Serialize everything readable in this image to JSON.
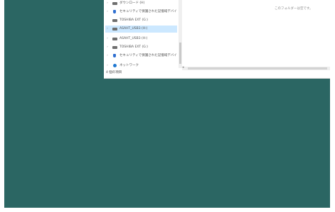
{
  "nav_pane": {
    "items": [
      {
        "label": "ダウンロード (H)",
        "icon": "drive-icon",
        "selected": false
      },
      {
        "label": "セキュリティで保護された記憶域デバイス",
        "icon": "shield-icon",
        "selected": false
      },
      {
        "label": "TOSHIBA EXT (G:)",
        "icon": "drive-icon",
        "selected": false
      },
      {
        "label": "ASAHT_USB3 (H:)",
        "icon": "drive-icon",
        "selected": true
      },
      {
        "label": "ASAHT_USB3 (H:)",
        "icon": "drive-icon",
        "selected": false
      },
      {
        "label": "TOSHIBA EXT (G:)",
        "icon": "drive-icon",
        "selected": false
      },
      {
        "label": "セキュリティで保護された記憶域デバイス",
        "icon": "shield-icon",
        "selected": false
      },
      {
        "label": "ネットワーク",
        "icon": "network-icon",
        "selected": false
      }
    ],
    "footer": "4 個の項目"
  },
  "content": {
    "empty_message": "このフォルダーは空です。"
  },
  "colors": {
    "desktop": "#2b6663",
    "selection": "#cce8ff"
  }
}
